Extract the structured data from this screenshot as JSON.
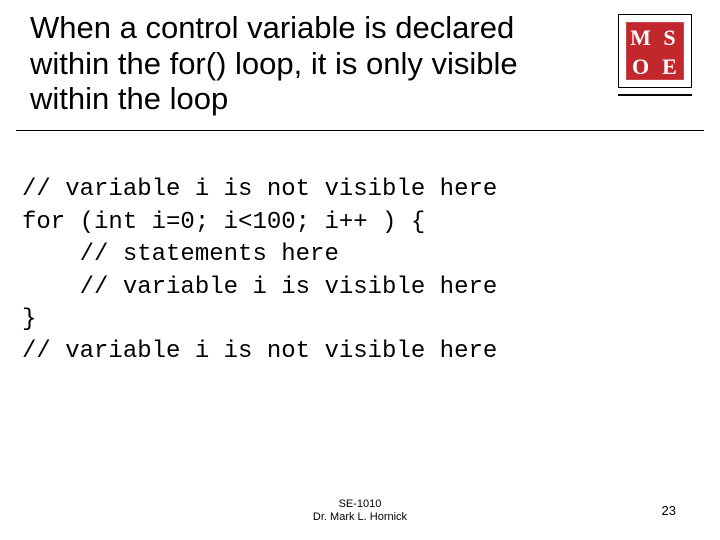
{
  "title": "When a control variable is declared within the for() loop, it is only visible within the loop",
  "logo": {
    "tl": "M",
    "tr": "S",
    "bl": "O",
    "br": "E"
  },
  "code_lines": [
    "// variable i is not visible here",
    "for (int i=0; i<100; i++ ) {",
    "    // statements here",
    "    // variable i is visible here",
    "}",
    "// variable i is not visible here"
  ],
  "footer": {
    "line1": "SE-1010",
    "line2": "Dr. Mark L. Hornick"
  },
  "page_number": "23"
}
